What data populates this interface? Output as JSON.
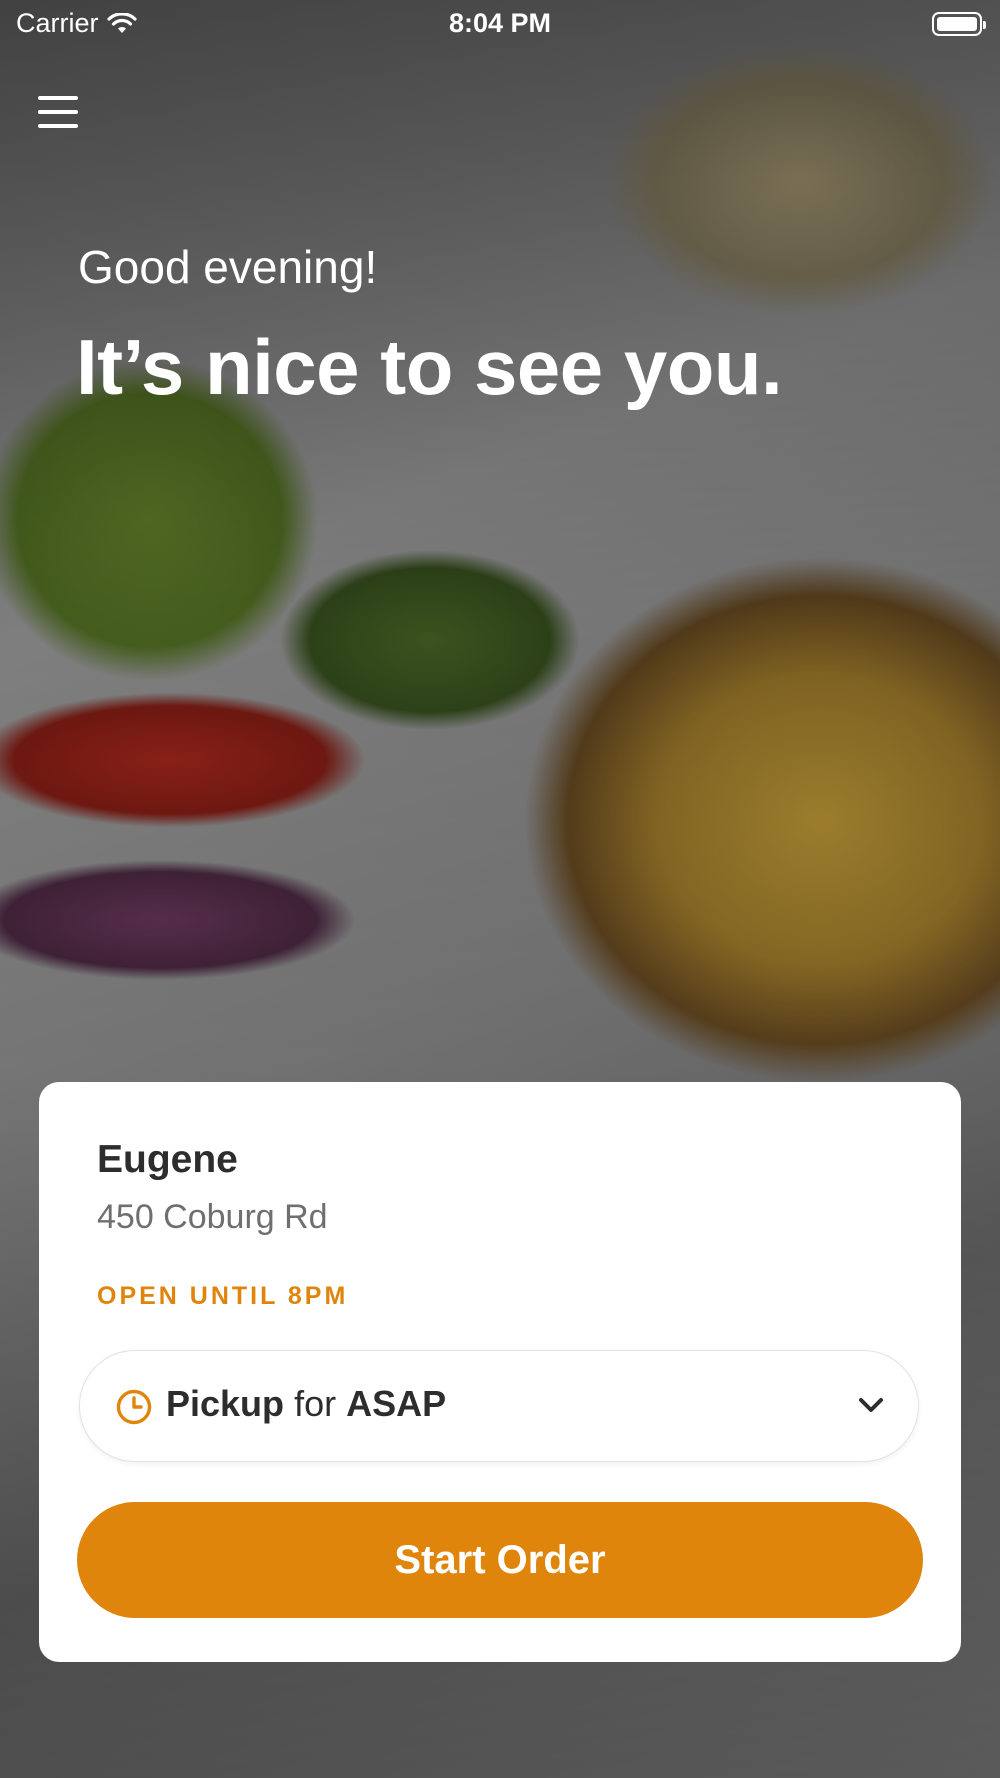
{
  "status_bar": {
    "carrier": "Carrier",
    "time": "8:04 PM"
  },
  "greeting": {
    "salutation": "Good evening!",
    "headline": "It’s nice to see you."
  },
  "location": {
    "name": "Eugene",
    "address": "450 Coburg Rd",
    "hours": "OPEN UNTIL 8PM"
  },
  "order_mode": {
    "mode": "Pickup",
    "connector": "for",
    "time": "ASAP"
  },
  "actions": {
    "start_order": "Start Order"
  },
  "colors": {
    "accent": "#e0850c",
    "card_bg": "#ffffff",
    "text_dark": "#2d2d2d",
    "text_muted": "#6f6f6f"
  },
  "icons": {
    "menu": "hamburger-menu-icon",
    "wifi": "wifi-icon",
    "battery": "battery-icon",
    "clock": "clock-icon",
    "dropdown": "chevron-down-icon"
  }
}
